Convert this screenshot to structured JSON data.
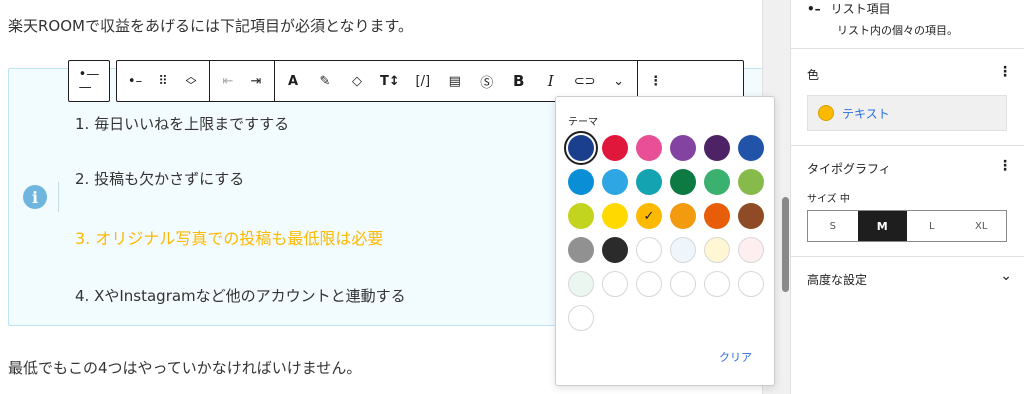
{
  "editor": {
    "intro_text": "楽天ROOMで収益をあげるには下記項目が必須となります。",
    "list_items": [
      "1. 毎日いいねを上限まですする",
      "2. 投稿も欠かさずにする",
      "3. オリジナル写真での投稿も最低限は必要",
      "4. XやInstagramなど他のアカウントと連動する"
    ],
    "outro_text": "最低でもこの4つはやっていかなければいけません。",
    "highlight_color": "#fcb900"
  },
  "toolbar": {
    "buttons": [
      {
        "name": "parent-block-button",
        "icon": "list-parent-icon"
      },
      {
        "name": "list-item-button",
        "icon": "list-item-icon",
        "glyph": "•–"
      },
      {
        "name": "drag-handle",
        "icon": "drag-icon",
        "glyph": "⠿"
      },
      {
        "name": "move-up-down",
        "icon": "chevron-updown-icon",
        "glyph": "⌃⌄"
      },
      {
        "name": "outdent-button",
        "icon": "outdent-icon",
        "glyph": "⇤"
      },
      {
        "name": "indent-button",
        "icon": "indent-icon",
        "glyph": "⇥"
      },
      {
        "name": "font-button",
        "glyph": "A"
      },
      {
        "name": "highlight-button",
        "icon": "brush-icon",
        "glyph": "🖌"
      },
      {
        "name": "tag-button",
        "icon": "tag-icon",
        "glyph": "⌂"
      },
      {
        "name": "font-size-button",
        "glyph": "TI"
      },
      {
        "name": "code-button",
        "glyph": "[/]"
      },
      {
        "name": "document-button",
        "icon": "document-icon",
        "glyph": "▤"
      },
      {
        "name": "coin-button",
        "icon": "coin-icon",
        "glyph": "$"
      },
      {
        "name": "bold-button",
        "glyph": "B"
      },
      {
        "name": "italic-button",
        "glyph": "I"
      },
      {
        "name": "link-button",
        "icon": "link-icon",
        "glyph": "⊂⊃"
      },
      {
        "name": "more-format-button",
        "icon": "chevron-down-icon",
        "glyph": "⌄"
      },
      {
        "name": "options-button",
        "icon": "more-vertical-icon",
        "glyph": "⋮"
      }
    ]
  },
  "popover": {
    "title": "テーマ",
    "clear_label": "クリア",
    "swatches": [
      {
        "color": "#1a3f8c",
        "state": "selected"
      },
      {
        "color": "#e0173a"
      },
      {
        "color": "#e84f97"
      },
      {
        "color": "#8244a0"
      },
      {
        "color": "#4d2366"
      },
      {
        "color": "#2154a8"
      },
      {
        "color": "#0a8fd6"
      },
      {
        "color": "#2da6e3"
      },
      {
        "color": "#14a3b0"
      },
      {
        "color": "#0c7a42"
      },
      {
        "color": "#3ab16f"
      },
      {
        "color": "#86bb4b"
      },
      {
        "color": "#c3d41e"
      },
      {
        "color": "#ffd900"
      },
      {
        "color": "#fcb900",
        "state": "checked"
      },
      {
        "color": "#f39b0f"
      },
      {
        "color": "#e85d0a"
      },
      {
        "color": "#8e4b25"
      },
      {
        "color": "#919191"
      },
      {
        "color": "#2b2b2b"
      },
      {
        "color": "#ffffff",
        "light": true
      },
      {
        "color": "#eef6fb",
        "light": true
      },
      {
        "color": "#fff6d4",
        "light": true
      },
      {
        "color": "#fdeef0",
        "light": true
      },
      {
        "color": "#eaf6ef",
        "light": true
      },
      {
        "color": "#ffffff",
        "light": true
      },
      {
        "color": "#ffffff",
        "light": true
      },
      {
        "color": "#ffffff",
        "light": true
      },
      {
        "color": "#ffffff",
        "light": true
      },
      {
        "color": "#ffffff",
        "light": true
      },
      {
        "color": "#ffffff",
        "light": true
      }
    ]
  },
  "sidebar": {
    "block_name": "リスト項目",
    "block_description": "リスト内の個々の項目。",
    "color_section": "色",
    "color_text_label": "テキスト",
    "typography_section": "タイポグラフィ",
    "size_label": "サイズ 中",
    "size_options": [
      "S",
      "M",
      "L",
      "XL"
    ],
    "size_selected": "M",
    "advanced_section": "高度な設定"
  }
}
